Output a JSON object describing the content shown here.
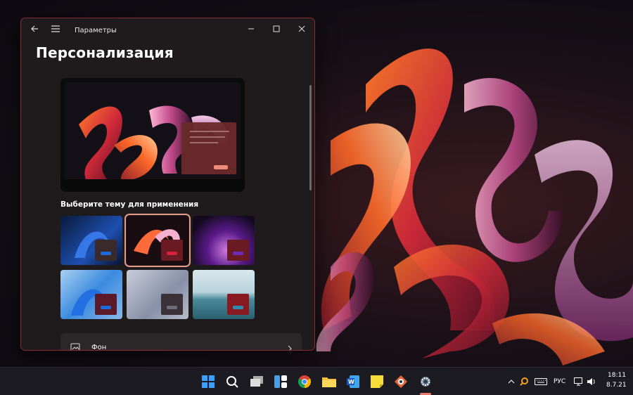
{
  "window": {
    "app_title": "Параметры",
    "page_title": "Персонализация",
    "themes_label": "Выберите тему для применения",
    "setting_row_label": "Фон"
  },
  "themes": [
    {
      "name": "theme-1",
      "accent": "#1e6bd6",
      "selected": false
    },
    {
      "name": "theme-2",
      "accent": "#d3223a",
      "selected": true
    },
    {
      "name": "theme-3",
      "accent": "#6a2bb8",
      "selected": false
    },
    {
      "name": "theme-4",
      "accent": "#1e6bd6",
      "selected": false
    },
    {
      "name": "theme-5",
      "accent": "#6c6c7a",
      "selected": false
    },
    {
      "name": "theme-6",
      "accent": "#2f8cb0",
      "selected": false
    }
  ],
  "taskbar": {
    "apps": [
      "start-icon",
      "search-icon",
      "task-view-icon",
      "widgets-icon",
      "chrome-icon",
      "file-explorer-icon",
      "word-icon",
      "sticky-notes-icon",
      "photo-viewer-icon",
      "settings-icon"
    ],
    "language": "РУС",
    "time": "18:11",
    "date": "8.7.21"
  },
  "colors": {
    "accent_border": "#8a2a33",
    "window_bg": "#1f1b1c",
    "taskbar_bg": "#1c1b21"
  }
}
